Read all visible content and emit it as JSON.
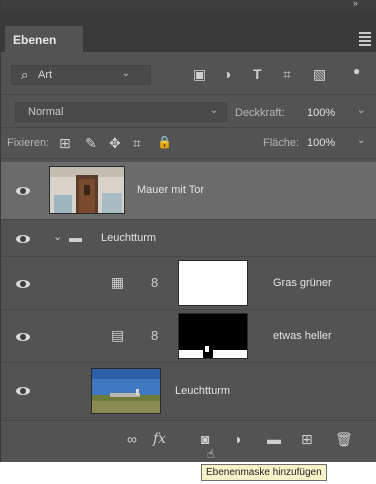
{
  "window": {
    "collapse_glyph": "»",
    "tab_label": "Ebenen",
    "panel_menu_icon": "hamburger-menu-icon"
  },
  "filter_bar": {
    "kind_label": "Art",
    "kind_icon": "search-icon",
    "filter_icons": [
      "image-filter-icon",
      "adjustment-filter-icon",
      "type-filter-icon",
      "shape-filter-icon",
      "smart-object-filter-icon"
    ],
    "filter_glyphs": [
      "▣",
      "◑",
      "T",
      "⌗",
      "▧"
    ]
  },
  "blend_bar": {
    "mode": "Normal",
    "opacity_label": "Deckkraft:",
    "opacity_value": "100%"
  },
  "lock_bar": {
    "label": "Fixieren:",
    "lock_icons": [
      "lock-transparent-pixels-icon",
      "lock-image-pixels-icon",
      "lock-position-icon",
      "lock-artboard-icon",
      "lock-all-icon"
    ],
    "lock_glyphs": [
      "⊞",
      "✎",
      "✥",
      "⌗",
      "🔒"
    ],
    "fill_label": "Fläche:",
    "fill_value": "100%"
  },
  "layers": [
    {
      "name": "Mauer mit Tor",
      "visible": true,
      "selected": true,
      "type": "pixel"
    },
    {
      "name": "Leuchtturm",
      "visible": true,
      "selected": false,
      "type": "group",
      "expanded": true
    },
    {
      "name": "Gras grüner",
      "visible": true,
      "selected": false,
      "type": "adjustment",
      "adjustment_icon": "hue-saturation-icon",
      "mask": "white"
    },
    {
      "name": "etwas heller",
      "visible": true,
      "selected": false,
      "type": "adjustment",
      "adjustment_icon": "levels-icon",
      "mask": "black"
    },
    {
      "name": "Leuchtturm",
      "visible": true,
      "selected": false,
      "type": "pixel"
    }
  ],
  "bottom_bar": {
    "buttons": [
      "link-layers-icon",
      "fx-icon",
      "add-layer-mask-icon",
      "new-adjustment-layer-icon",
      "new-group-icon",
      "new-layer-icon",
      "delete-layer-icon"
    ],
    "fx_label": "fx"
  },
  "tooltip": "Ebenenmaske hinzufügen",
  "colors": {
    "panel_bg": "#535353",
    "selected_row": "#6b6b6b",
    "tab_bar": "#3a3a3a",
    "tooltip_bg": "#f7f3c8"
  }
}
